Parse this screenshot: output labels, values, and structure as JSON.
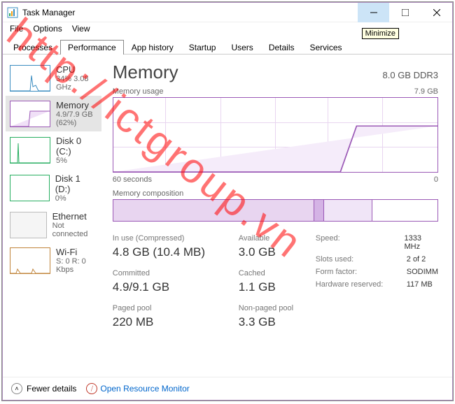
{
  "window": {
    "title": "Task Manager",
    "minimize_tooltip": "Minimize"
  },
  "menu": {
    "file": "File",
    "options": "Options",
    "view": "View"
  },
  "tabs": [
    "Processes",
    "Performance",
    "App history",
    "Startup",
    "Users",
    "Details",
    "Services"
  ],
  "sidebar": [
    {
      "name": "CPU",
      "sub": "34% 3.08 GHz"
    },
    {
      "name": "Memory",
      "sub": "4.9/7.9 GB (62%)"
    },
    {
      "name": "Disk 0 (C:)",
      "sub": "5%"
    },
    {
      "name": "Disk 1 (D:)",
      "sub": "0%"
    },
    {
      "name": "Ethernet",
      "sub": "Not connected"
    },
    {
      "name": "Wi-Fi",
      "sub": "S: 0 R: 0 Kbps"
    }
  ],
  "main": {
    "title": "Memory",
    "capacity": "8.0 GB DDR3",
    "usage_label": "Memory usage",
    "usage_max": "7.9 GB",
    "time_left": "60 seconds",
    "time_right": "0",
    "comp_label": "Memory composition"
  },
  "stats": {
    "inuse_label": "In use (Compressed)",
    "inuse": "4.8 GB (10.4 MB)",
    "avail_label": "Available",
    "avail": "3.0 GB",
    "committed_label": "Committed",
    "committed": "4.9/9.1 GB",
    "cached_label": "Cached",
    "cached": "1.1 GB",
    "paged_label": "Paged pool",
    "paged": "220 MB",
    "nonpaged_label": "Non-paged pool",
    "nonpaged": "3.3 GB",
    "speed_label": "Speed:",
    "speed": "1333 MHz",
    "slots_label": "Slots used:",
    "slots": "2 of 2",
    "form_label": "Form factor:",
    "form": "SODIMM",
    "reserved_label": "Hardware reserved:",
    "reserved": "117 MB"
  },
  "footer": {
    "fewer": "Fewer details",
    "monitor": "Open Resource Monitor"
  },
  "watermark": "http://ictgroup.vn",
  "chart_data": {
    "type": "line",
    "title": "Memory usage",
    "xlabel": "seconds",
    "ylabel": "GB",
    "xlim": [
      60,
      0
    ],
    "ylim": [
      0,
      7.9
    ],
    "x": [
      60,
      14,
      13,
      0
    ],
    "values": [
      0,
      0,
      4.9,
      4.9
    ],
    "composition": {
      "in_use_pct": 62,
      "modified_pct": 3,
      "standby_pct": 15,
      "free_pct": 20
    }
  }
}
